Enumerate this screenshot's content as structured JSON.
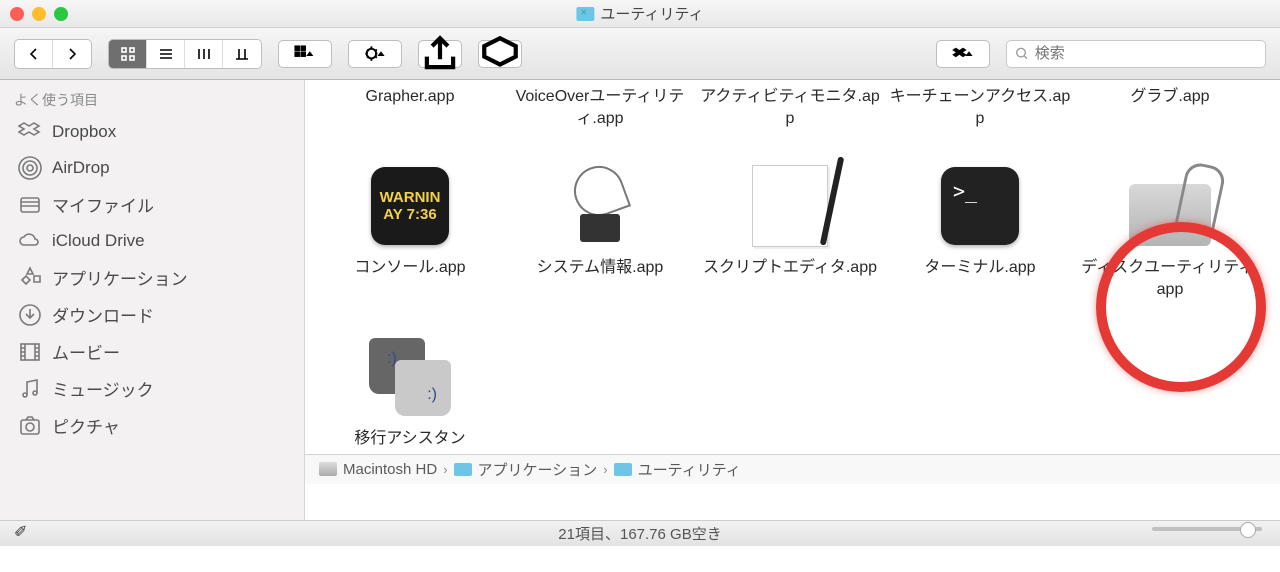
{
  "window": {
    "title": "ユーティリティ"
  },
  "search": {
    "placeholder": "検索"
  },
  "sidebar": {
    "header": "よく使う項目",
    "items": [
      {
        "label": "Dropbox"
      },
      {
        "label": "AirDrop"
      },
      {
        "label": "マイファイル"
      },
      {
        "label": "iCloud Drive"
      },
      {
        "label": "アプリケーション"
      },
      {
        "label": "ダウンロード"
      },
      {
        "label": "ムービー"
      },
      {
        "label": "ミュージック"
      },
      {
        "label": "ピクチャ"
      }
    ]
  },
  "row1": [
    {
      "label": "Grapher.app"
    },
    {
      "label": "VoiceOverユーティリティ.app"
    },
    {
      "label": "アクティビティモニタ.app"
    },
    {
      "label": "キーチェーンアクセス.app"
    },
    {
      "label": "グラブ.app"
    }
  ],
  "row2": [
    {
      "label": "コンソール.app",
      "icon": "console",
      "line1": "WARNIN",
      "line2": "AY 7:36"
    },
    {
      "label": "システム情報.app",
      "icon": "sysinfo"
    },
    {
      "label": "スクリプトエディタ.app",
      "icon": "script"
    },
    {
      "label": "ターミナル.app",
      "icon": "terminal",
      "prompt": ">_"
    },
    {
      "label": "ディスクユーティリティ.app",
      "icon": "disk"
    }
  ],
  "row3": [
    {
      "label": "移行アシスタン",
      "icon": "migrate"
    }
  ],
  "path": {
    "seg0": "Macintosh HD",
    "seg1": "アプリケーション",
    "seg2": "ユーティリティ"
  },
  "status": {
    "text": "21項目、167.76 GB空き"
  }
}
